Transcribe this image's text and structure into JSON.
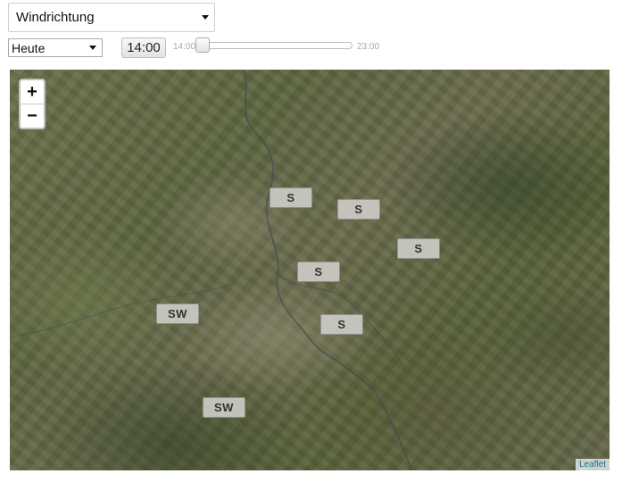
{
  "controls": {
    "parameter_select": {
      "value": "Windrichtung"
    },
    "day_select": {
      "value": "Heute"
    },
    "time_display": "14:00",
    "time_slider": {
      "min_label": "14:00",
      "max_label": "23:00",
      "position_fraction": 0.0
    }
  },
  "map": {
    "zoom_in_label": "+",
    "zoom_out_label": "−",
    "attribution": "Leaflet",
    "markers": [
      {
        "label": "S"
      },
      {
        "label": "S"
      },
      {
        "label": "S"
      },
      {
        "label": "S"
      },
      {
        "label": "S"
      },
      {
        "label": "SW"
      },
      {
        "label": "SW"
      }
    ]
  }
}
